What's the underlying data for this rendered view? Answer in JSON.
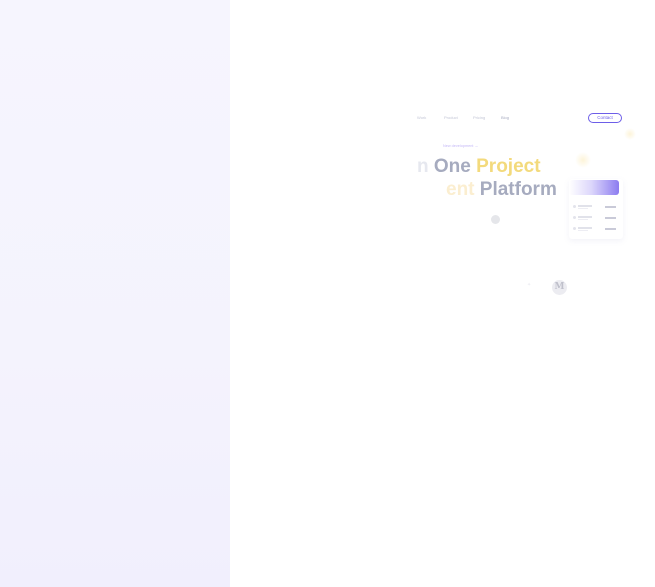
{
  "nav": {
    "links": [
      "Work",
      "Product",
      "Pricing",
      "Blog"
    ],
    "contact_label": "Contact"
  },
  "hero": {
    "badge": "New development →",
    "line1_prefix": "n",
    "line1_word1": "One",
    "line1_word2": "Project",
    "line2_prefix": "ent",
    "line2_word1": "Platform"
  },
  "logos": {
    "primary": "M",
    "secondary": "✦"
  },
  "colors": {
    "accent": "#6d5ee8",
    "hero_gray": "#a6abbf",
    "hero_yellow": "#f3da7c",
    "left_panel": "#f4f3fd"
  },
  "icons": [
    "orb-icon",
    "sun-glow-icon",
    "m-logo-icon"
  ]
}
